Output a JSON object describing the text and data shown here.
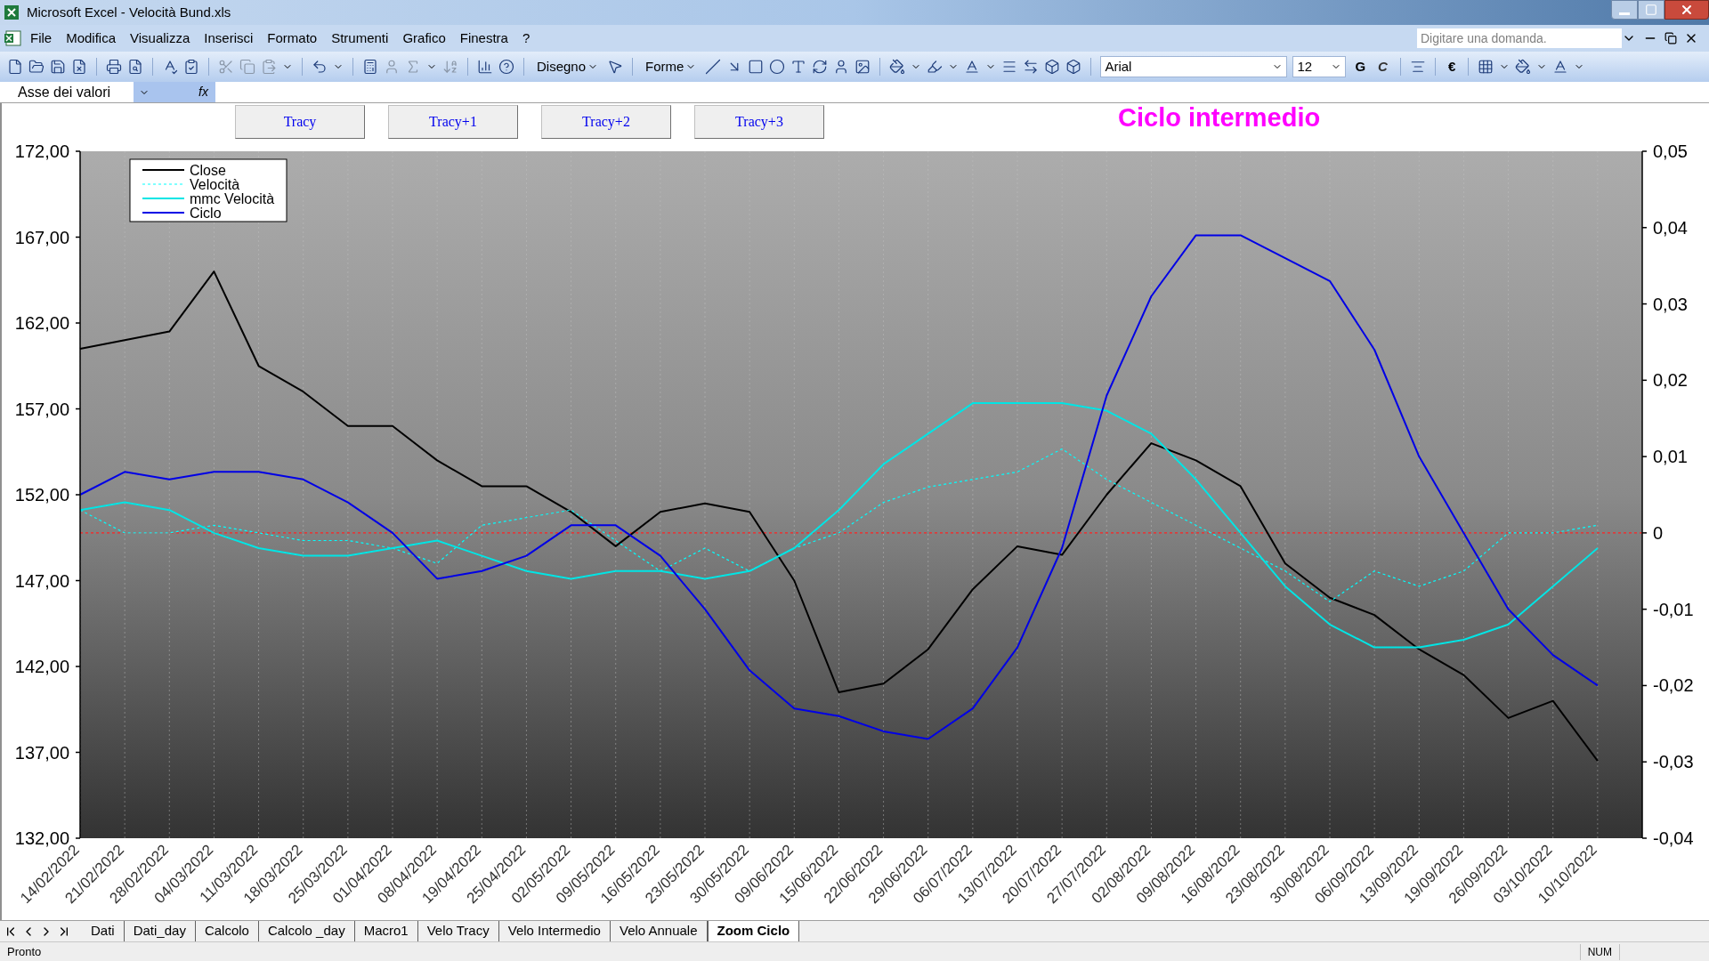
{
  "window": {
    "title": "Microsoft Excel - Velocità Bund.xls"
  },
  "menu": {
    "items": [
      "File",
      "Modifica",
      "Visualizza",
      "Inserisci",
      "Formato",
      "Strumenti",
      "Grafico",
      "Finestra",
      "?"
    ],
    "question_box": {
      "placeholder": "Digitare una domanda."
    }
  },
  "toolbar": {
    "draw_menu": "Disegno",
    "shapes_menu": "Forme",
    "font": "Arial",
    "font_size": "12",
    "bold_button": "G",
    "italic_button": "C",
    "currency_button": "€"
  },
  "formula_bar": {
    "name_box": "Asse dei valori",
    "function_label": "fx"
  },
  "chart_sheet": {
    "buttons": [
      "Tracy",
      "Tracy+1",
      "Tracy+2",
      "Tracy+3"
    ],
    "title": "Ciclo intermedio",
    "chart_data": {
      "type": "line",
      "grid": "x",
      "legend": true,
      "ref_lines": [
        {
          "axis": "y2",
          "value": 0,
          "color": "#ff2020",
          "line_style": "dotted"
        }
      ],
      "categories": [
        "14/02/2022",
        "21/02/2022",
        "28/02/2022",
        "04/03/2022",
        "11/03/2022",
        "18/03/2022",
        "25/03/2022",
        "01/04/2022",
        "08/04/2022",
        "19/04/2022",
        "25/04/2022",
        "02/05/2022",
        "09/05/2022",
        "16/05/2022",
        "23/05/2022",
        "30/05/2022",
        "09/06/2022",
        "15/06/2022",
        "22/06/2022",
        "29/06/2022",
        "06/07/2022",
        "13/07/2022",
        "20/07/2022",
        "27/07/2022",
        "02/08/2022",
        "09/08/2022",
        "16/08/2022",
        "23/08/2022",
        "30/08/2022",
        "06/09/2022",
        "13/09/2022",
        "19/09/2022",
        "26/09/2022",
        "03/10/2022",
        "10/10/2022"
      ],
      "ylim": [
        132,
        172
      ],
      "yticks": [
        {
          "value": 132,
          "label": "132,00"
        },
        {
          "value": 137,
          "label": "137,00"
        },
        {
          "value": 142,
          "label": "142,00"
        },
        {
          "value": 147,
          "label": "147,00"
        },
        {
          "value": 152,
          "label": "152,00"
        },
        {
          "value": 157,
          "label": "157,00"
        },
        {
          "value": 162,
          "label": "162,00"
        },
        {
          "value": 167,
          "label": "167,00"
        },
        {
          "value": 172,
          "label": "172,00"
        }
      ],
      "y2lim": [
        -0.04,
        0.05
      ],
      "y2ticks": [
        {
          "value": -0.04,
          "label": "-0,04"
        },
        {
          "value": -0.03,
          "label": "-0,03"
        },
        {
          "value": -0.02,
          "label": "-0,02"
        },
        {
          "value": -0.01,
          "label": "-0,01"
        },
        {
          "value": 0,
          "label": "0"
        },
        {
          "value": 0.01,
          "label": "0,01"
        },
        {
          "value": 0.02,
          "label": "0,02"
        },
        {
          "value": 0.03,
          "label": "0,03"
        },
        {
          "value": 0.04,
          "label": "0,04"
        },
        {
          "value": 0.05,
          "label": "0,05"
        }
      ],
      "series": [
        {
          "name": "Close",
          "color": "#000000",
          "values": [
            160.5,
            161,
            161.5,
            165,
            159.5,
            158,
            156,
            156,
            154,
            152.5,
            152.5,
            151,
            149,
            151,
            151.5,
            151,
            147,
            140.5,
            141,
            143,
            146.5,
            149,
            148.5,
            152,
            155,
            154,
            152.5,
            148,
            146,
            145,
            143,
            141.5,
            139,
            140,
            136.5
          ]
        },
        {
          "name": "Velocità",
          "color": "#00ffff",
          "axis": "y2",
          "line_style": "dotted",
          "values": [
            0.003,
            0,
            0,
            0.001,
            0,
            -0.001,
            -0.001,
            -0.002,
            -0.004,
            0.001,
            0.002,
            0.003,
            -0.001,
            -0.005,
            -0.002,
            -0.005,
            -0.002,
            0,
            0.004,
            0.006,
            0.007,
            0.008,
            0.011,
            0.007,
            0.004,
            0.001,
            -0.002,
            -0.005,
            -0.009,
            -0.005,
            -0.007,
            -0.005,
            0,
            0,
            0.001
          ]
        },
        {
          "name": "mmc Velocità",
          "color": "#00e5e5",
          "axis": "y2",
          "values": [
            0.003,
            0.004,
            0.003,
            0,
            -0.002,
            -0.003,
            -0.003,
            -0.002,
            -0.001,
            -0.003,
            -0.005,
            -0.006,
            -0.005,
            -0.005,
            -0.006,
            -0.005,
            -0.002,
            0.003,
            0.009,
            0.013,
            0.017,
            0.017,
            0.017,
            0.016,
            0.013,
            0.007,
            0,
            -0.007,
            -0.012,
            -0.015,
            -0.015,
            -0.014,
            -0.012,
            -0.007,
            -0.002
          ]
        },
        {
          "name": "Ciclo",
          "color": "#0000e6",
          "axis": "y2",
          "values": [
            0.005,
            0.008,
            0.007,
            0.008,
            0.008,
            0.007,
            0.004,
            0,
            -0.006,
            -0.005,
            -0.003,
            0.001,
            0.001,
            -0.003,
            -0.01,
            -0.018,
            -0.023,
            -0.024,
            -0.026,
            -0.027,
            -0.023,
            -0.015,
            -0.002,
            0.018,
            0.031,
            0.039,
            0.039,
            0.036,
            0.033,
            0.024,
            0.01,
            0,
            -0.01,
            -0.016,
            -0.02
          ]
        }
      ]
    }
  },
  "sheet_tabs": [
    {
      "label": "Dati",
      "selected": false
    },
    {
      "label": "Dati_day",
      "selected": false
    },
    {
      "label": "Calcolo",
      "selected": false
    },
    {
      "label": "Calcolo _day",
      "selected": false
    },
    {
      "label": "Macro1",
      "selected": false
    },
    {
      "label": "Velo Tracy",
      "selected": false
    },
    {
      "label": "Velo Intermedio",
      "selected": false
    },
    {
      "label": "Velo Annuale",
      "selected": false
    },
    {
      "label": "Zoom Ciclo",
      "selected": true
    }
  ],
  "status_bar": {
    "text": "Pronto",
    "num_indicator": "NUM"
  }
}
